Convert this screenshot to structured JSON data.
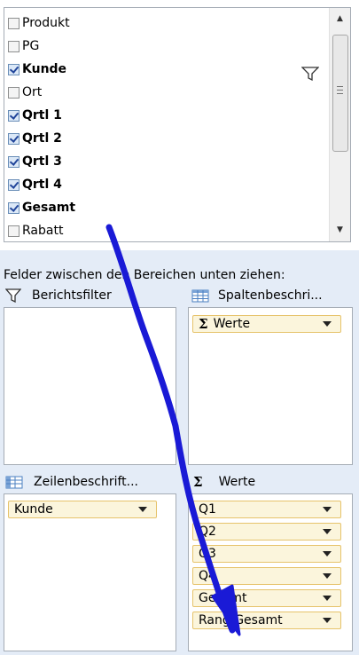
{
  "field_list": {
    "items": [
      {
        "label": "Produkt",
        "checked": false
      },
      {
        "label": "PG",
        "checked": false
      },
      {
        "label": "Kunde",
        "checked": true
      },
      {
        "label": "Ort",
        "checked": false
      },
      {
        "label": "Qrtl 1",
        "checked": true
      },
      {
        "label": "Qrtl 2",
        "checked": true
      },
      {
        "label": "Qrtl 3",
        "checked": true
      },
      {
        "label": "Qrtl 4",
        "checked": true
      },
      {
        "label": "Gesamt",
        "checked": true
      },
      {
        "label": "Rabatt",
        "checked": false
      }
    ],
    "filtered_field_icon": "funnel-icon"
  },
  "areas": {
    "instruction": "Felder zwischen den Bereichen unten ziehen:",
    "report_filter": {
      "label": "Berichtsfilter",
      "icon": "funnel-icon"
    },
    "column_labels": {
      "label": "Spaltenbeschri...",
      "icon": "table-icon",
      "chips": [
        "Werte"
      ]
    },
    "row_labels": {
      "label": "Zeilenbeschrift...",
      "icon": "table-icon",
      "chips": [
        "Kunde"
      ]
    },
    "values": {
      "label": "Werte",
      "icon": "sigma-icon",
      "chips": [
        "Q1",
        "Q2",
        "Q3",
        "Q4",
        "Gesamt",
        "Rang Gesamt"
      ]
    }
  },
  "annotation": {
    "color": "#1a1ad6",
    "meaning": "drag-arrow"
  },
  "sigma_glyph": "Σ"
}
